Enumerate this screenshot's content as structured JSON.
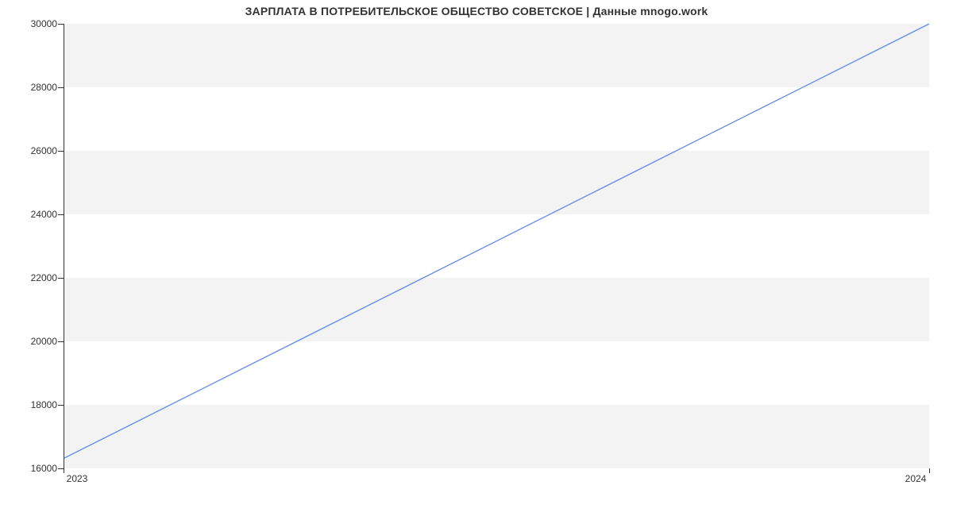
{
  "chart_data": {
    "type": "line",
    "title": "ЗАРПЛАТА В ПОТРЕБИТЕЛЬСКОЕ ОБЩЕСТВО СОВЕТСКОЕ | Данные mnogo.work",
    "xlabel": "",
    "ylabel": "",
    "x_ticks": [
      "2023",
      "2024"
    ],
    "y_ticks": [
      16000,
      18000,
      20000,
      22000,
      24000,
      26000,
      28000,
      30000
    ],
    "xlim": [
      2023,
      2024
    ],
    "ylim": [
      16000,
      30000
    ],
    "series": [
      {
        "name": "salary",
        "x": [
          2023,
          2024
        ],
        "values": [
          16300,
          30000
        ],
        "color": "#6a8fe8"
      }
    ],
    "grid_bands": true
  },
  "labels": {
    "y16000": "16000",
    "y18000": "18000",
    "y20000": "20000",
    "y22000": "22000",
    "y24000": "24000",
    "y26000": "26000",
    "y28000": "28000",
    "y30000": "30000",
    "x2023": "2023",
    "x2024": "2024"
  }
}
